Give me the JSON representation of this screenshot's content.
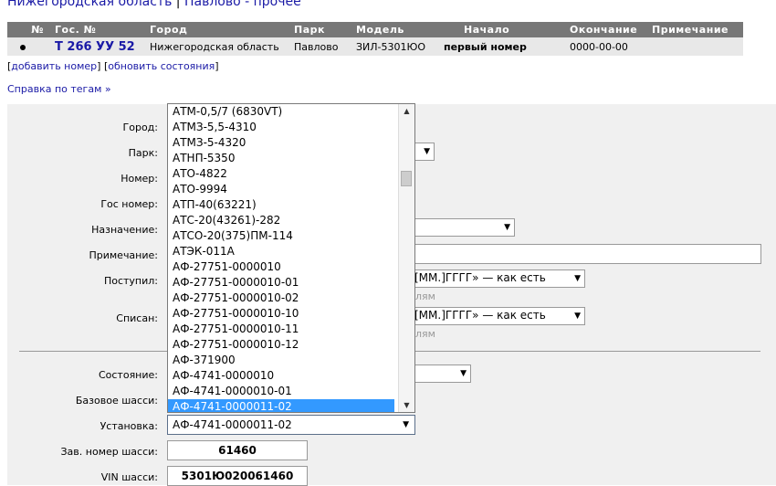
{
  "breadcrumb": {
    "region": "Нижегородская область",
    "separator": "|",
    "park": "Павлово - прочее"
  },
  "vehicle_table": {
    "headers": [
      "№",
      "Гос. №",
      "Город",
      "Парк",
      "Модель",
      "Начало",
      "Окончание",
      "Примечание"
    ],
    "rows": [
      {
        "plate": "Т 266 УУ 52",
        "city": "Нижегородская область",
        "park": "Павлово",
        "model": "ЗИЛ-5301ЮО",
        "start": "первый номер",
        "end": "0000-00-00",
        "note": ""
      }
    ]
  },
  "actions": {
    "open1": "[",
    "add": "добавить номер",
    "mid": "] [",
    "refresh": "обновить состояния",
    "close": "]"
  },
  "help_link": "Справка по тегам »",
  "form": {
    "labels": {
      "city": "Город:",
      "park": "Парк:",
      "number": "Номер:",
      "gos_number": "Гос номер:",
      "purpose": "Назначение:",
      "note": "Примечание:",
      "received": "Поступил:",
      "written_off": "Списан:",
      "state": "Состояние:",
      "base_chassis": "Базовое шасси:",
      "installation": "Установка:",
      "chassis_factory_number": "Зав. номер шасси:",
      "vin": "VIN шасси:"
    },
    "date_format_option": "[ММ.]ГГГГ» — как есть",
    "date_hint": "лям",
    "chassis_factory_number_value": "61460",
    "vin_value": "5301Ю020061460",
    "installation_value": "АФ-4741-0000011-02"
  },
  "dropdown": {
    "items": [
      "АТМ-0,5/7 (6830VT)",
      "АТМЗ-5,5-4310",
      "АТМЗ-5-4320",
      "АТНП-5350",
      "АТО-4822",
      "АТО-9994",
      "АТП-40(63221)",
      "АТС-20(43261)-282",
      "АТСО-20(375)ПМ-114",
      "АТЭК-011А",
      "АФ-27751-0000010",
      "АФ-27751-0000010-01",
      "АФ-27751-0000010-02",
      "АФ-27751-0000010-10",
      "АФ-27751-0000010-11",
      "АФ-27751-0000010-12",
      "АФ-371900",
      "АФ-4741-0000010",
      "АФ-4741-0000010-01",
      "АФ-4741-0000011-02"
    ],
    "selected_index": 19
  }
}
